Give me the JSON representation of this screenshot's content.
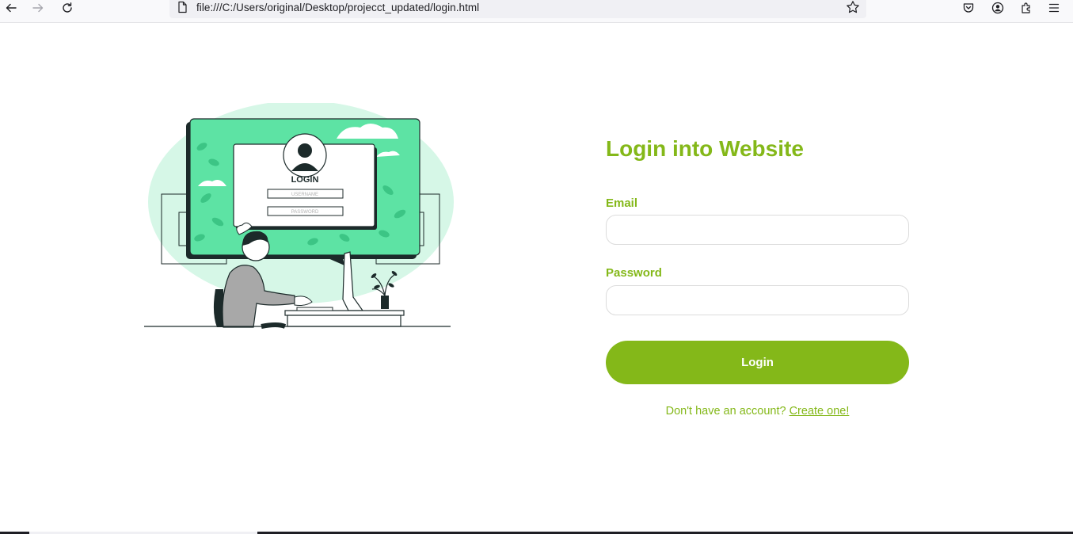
{
  "browser": {
    "url": "file:///C:/Users/original/Desktop/projecct_updated/login.html"
  },
  "form": {
    "title": "Login into Website",
    "email_label": "Email",
    "email_value": "",
    "password_label": "Password",
    "password_value": "",
    "login_label": "Login",
    "signup_prompt": "Don't have an account?",
    "signup_link": "Create one!"
  },
  "illustration": {
    "screen_title": "LOGIN",
    "username_placeholder": "USERNAME",
    "password_placeholder": "PASSWORD"
  },
  "colors": {
    "accent": "#84b819",
    "illustration_green": "#5de3a4",
    "illustration_blob": "#d6f7e7",
    "dark": "#1c2a2a"
  }
}
